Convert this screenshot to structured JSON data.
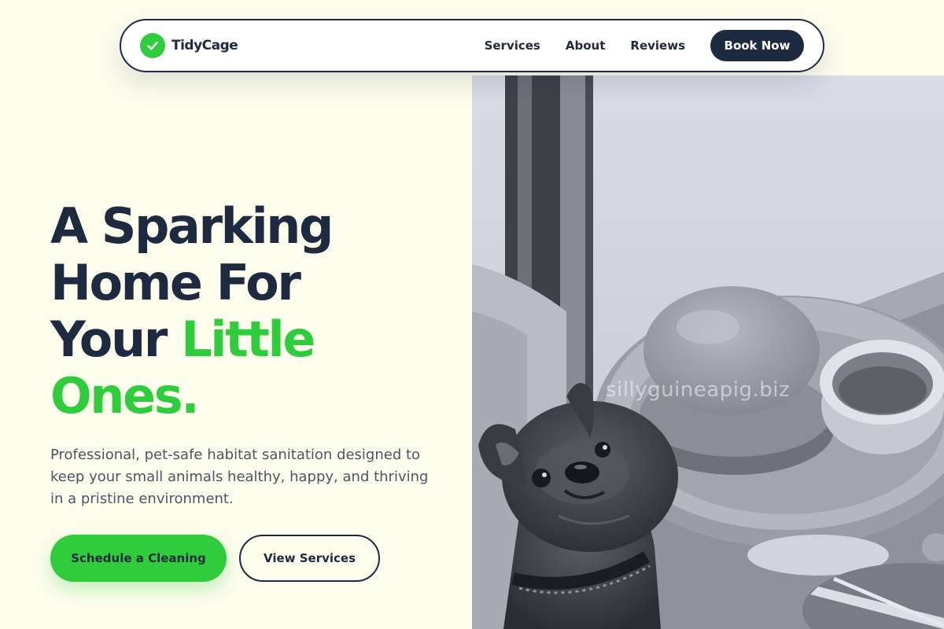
{
  "nav": {
    "brand": "TidyCage",
    "links": [
      {
        "label": "Services"
      },
      {
        "label": "About"
      },
      {
        "label": "Reviews"
      }
    ],
    "cta": "Book Now"
  },
  "hero": {
    "title_line1": "A Sparking",
    "title_line2": "Home For",
    "title_line3_plain": "Your ",
    "title_line3_accent": "Little",
    "title_line4_accent": "Ones.",
    "subtitle": "Professional, pet-safe habitat sanitation designed to keep your small animals healthy, happy, and thriving in a pristine environment.",
    "primary_cta": "Schedule a Cleaning",
    "secondary_cta": "View Services"
  },
  "image": {
    "watermark": "sillyguineapig.biz",
    "subject": "grayscale photo of a French bulldog puppy sitting beside a cafe table with a burger and a cup"
  },
  "colors": {
    "background": "#fdfdee",
    "navy": "#1e2a3f",
    "accent_green": "#2fcc3c",
    "body_text": "#4d5565"
  },
  "icons": {
    "logo": "checkmark-circle-icon"
  }
}
